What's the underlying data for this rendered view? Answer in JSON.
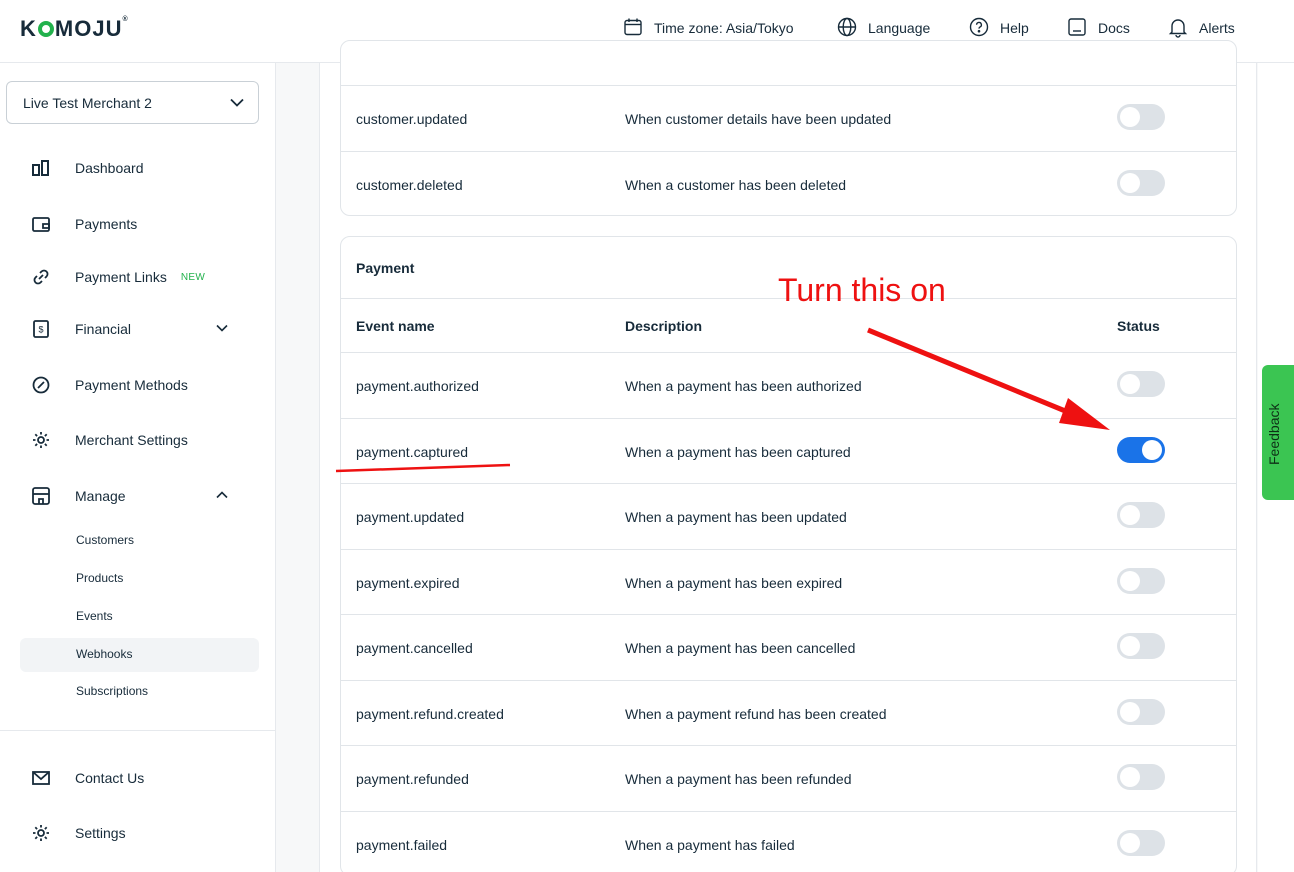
{
  "header": {
    "logo": "KOMOJU",
    "timezone": "Time zone: Asia/Tokyo",
    "language": "Language",
    "help": "Help",
    "docs": "Docs",
    "alerts": "Alerts"
  },
  "sidebar": {
    "merchant": "Live Test Merchant 2",
    "items": [
      {
        "label": "Dashboard",
        "icon": "dashboard-icon"
      },
      {
        "label": "Payments",
        "icon": "wallet-icon"
      },
      {
        "label": "Payment Links",
        "icon": "link-icon",
        "badge": "NEW"
      },
      {
        "label": "Financial",
        "icon": "dollar-doc-icon"
      },
      {
        "label": "Payment Methods",
        "icon": "payment-methods-icon"
      },
      {
        "label": "Merchant Settings",
        "icon": "gear-icon"
      },
      {
        "label": "Manage",
        "icon": "store-icon"
      }
    ],
    "manage_sub": [
      "Customers",
      "Products",
      "Events",
      "Webhooks",
      "Subscriptions"
    ],
    "active_sub": "Webhooks",
    "bottom": [
      {
        "label": "Contact Us",
        "icon": "mail-icon"
      },
      {
        "label": "Settings",
        "icon": "gear-icon"
      }
    ]
  },
  "customer_card": {
    "rows": [
      {
        "event": "customer.updated",
        "description": "When customer details have been updated",
        "enabled": false
      },
      {
        "event": "customer.deleted",
        "description": "When a customer has been deleted",
        "enabled": false
      }
    ]
  },
  "payment_card": {
    "title": "Payment",
    "columns": {
      "event": "Event name",
      "description": "Description",
      "status": "Status"
    },
    "rows": [
      {
        "event": "payment.authorized",
        "description": "When a payment has been authorized",
        "enabled": false
      },
      {
        "event": "payment.captured",
        "description": "When a payment has been captured",
        "enabled": true
      },
      {
        "event": "payment.updated",
        "description": "When a payment has been updated",
        "enabled": false
      },
      {
        "event": "payment.expired",
        "description": "When a payment has been expired",
        "enabled": false
      },
      {
        "event": "payment.cancelled",
        "description": "When a payment has been cancelled",
        "enabled": false
      },
      {
        "event": "payment.refund.created",
        "description": "When a payment refund has been created",
        "enabled": false
      },
      {
        "event": "payment.refunded",
        "description": "When a payment has been refunded",
        "enabled": false
      },
      {
        "event": "payment.failed",
        "description": "When a payment has failed",
        "enabled": false
      }
    ]
  },
  "feedback": "Feedback",
  "annotation": "Turn this on",
  "colors": {
    "accent": "#1a73e8",
    "brand": "#22b14c",
    "annotation": "#ee1111",
    "feedback": "#3bc552"
  }
}
